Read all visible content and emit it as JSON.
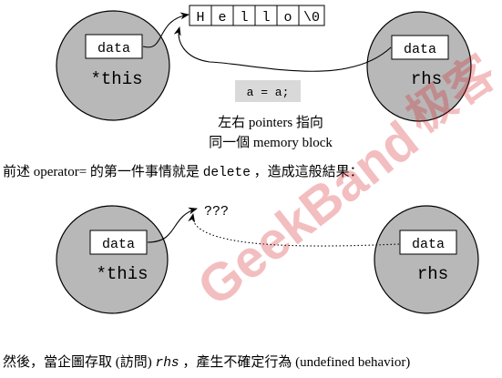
{
  "colors": {
    "ellipse_fill": "#b8b8b8",
    "code_box_fill": "#d9d9d9",
    "watermark": "#d71920"
  },
  "diagram1": {
    "left_box": "data",
    "left_label": "*this",
    "right_box": "data",
    "right_label": "rhs",
    "string_cells": [
      "H",
      "e",
      "l",
      "l",
      "o",
      "\\0"
    ],
    "code": "a = a;",
    "caption_line1": "左右 pointers 指向",
    "caption_line2": "同一個 memory block"
  },
  "middle_text": {
    "part1": "前述 operator= 的第一件事情就是 ",
    "code": "delete",
    "part2": "，造成這般結果："
  },
  "diagram2": {
    "left_box": "data",
    "left_label": "*this",
    "right_box": "data",
    "right_label": "rhs",
    "unknown": "???"
  },
  "bottom_text": {
    "part1": "然後，當企圖存取 (訪問) ",
    "code": "rhs",
    "part2": "，產生不確定行為 (undefined behavior)"
  },
  "watermark": {
    "main": "GeekBand",
    "corner": "极客"
  }
}
